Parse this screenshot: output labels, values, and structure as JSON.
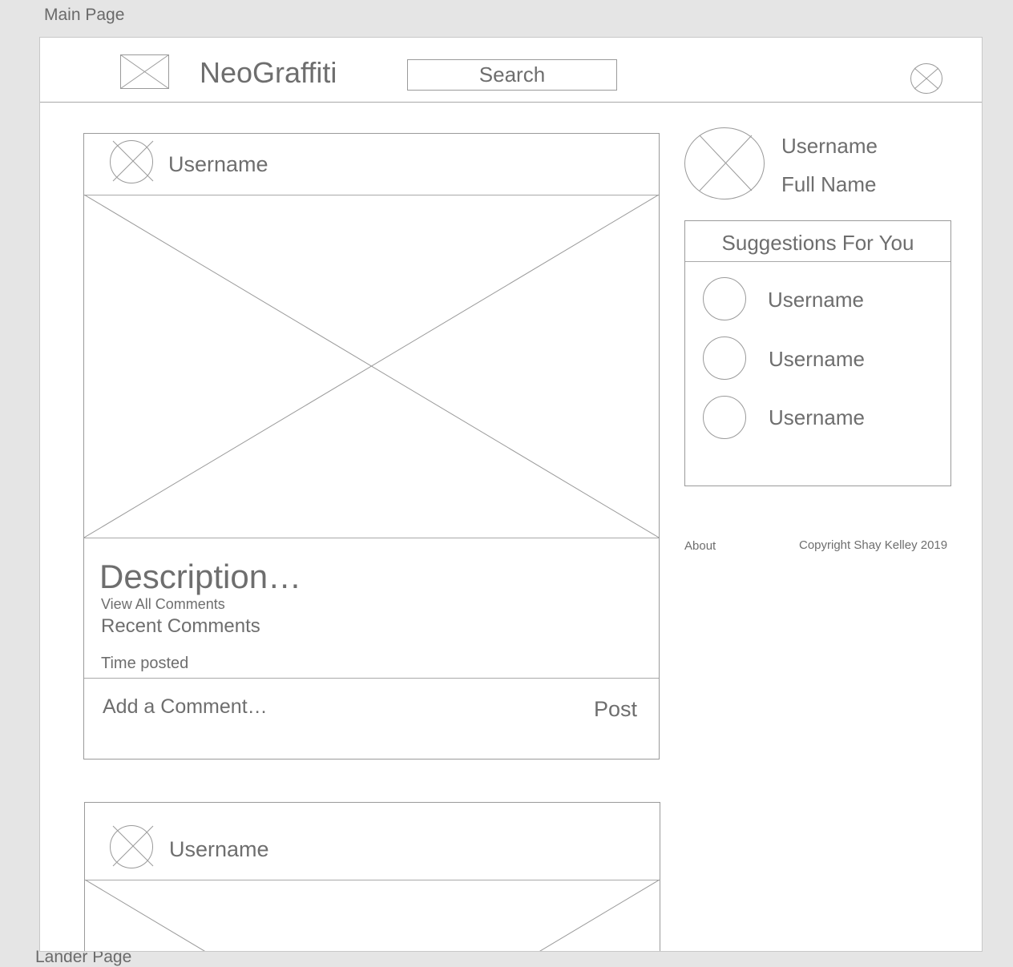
{
  "canvas": {
    "artboard_label": "Main Page",
    "next_artboard_label": "Lander Page"
  },
  "header": {
    "app_name": "NeoGraffiti",
    "search_placeholder": "Search"
  },
  "posts": [
    {
      "username": "Username",
      "description": "Description…",
      "view_all_comments": "View All Comments",
      "recent_comments": "Recent Comments",
      "time_posted": "Time posted",
      "add_comment_placeholder": "Add a Comment…",
      "post_button": "Post"
    },
    {
      "username": "Username"
    }
  ],
  "profile": {
    "username": "Username",
    "full_name": "Full Name"
  },
  "suggestions": {
    "title": "Suggestions For You",
    "users": [
      "Username",
      "Username",
      "Username"
    ]
  },
  "footer": {
    "about": "About",
    "copyright": "Copyright Shay Kelley 2019"
  },
  "colors": {
    "canvas_background": "#e5e5e5",
    "artboard_background": "#ffffff",
    "wire_stroke": "#9a9a9a",
    "text": "#6e6e6e"
  }
}
